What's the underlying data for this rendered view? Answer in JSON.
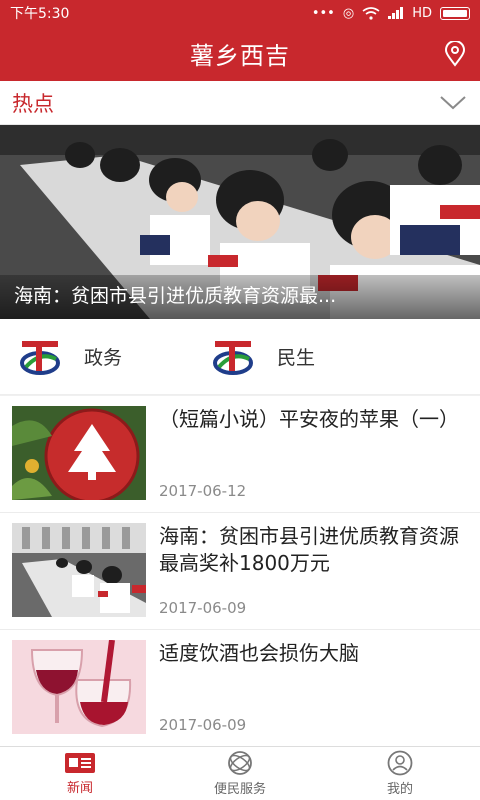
{
  "status_bar": {
    "time": "下午5:30",
    "network": "HD"
  },
  "app": {
    "title": "薯乡西吉"
  },
  "hot_section": {
    "title": "热点"
  },
  "banner": {
    "caption": "海南：贫困市县引进优质教育资源最..."
  },
  "categories": [
    {
      "label": "政务",
      "icon": "gov-logo-icon"
    },
    {
      "label": "民生",
      "icon": "gov-logo-icon"
    }
  ],
  "news": [
    {
      "title": "（短篇小说）平安夜的苹果（一）",
      "date": "2017-06-12"
    },
    {
      "title": "海南：贫困市县引进优质教育资源最高奖补1800万元",
      "date": "2017-06-09"
    },
    {
      "title": "适度饮酒也会损伤大脑",
      "date": "2017-06-09"
    }
  ],
  "tabs": [
    {
      "label": "新闻",
      "icon": "news-icon",
      "active": true
    },
    {
      "label": "便民服务",
      "icon": "service-icon",
      "active": false
    },
    {
      "label": "我的",
      "icon": "profile-icon",
      "active": false
    }
  ],
  "colors": {
    "brand_red": "#c8282d",
    "text_dark": "#222222",
    "text_gray": "#8a8a8a"
  }
}
